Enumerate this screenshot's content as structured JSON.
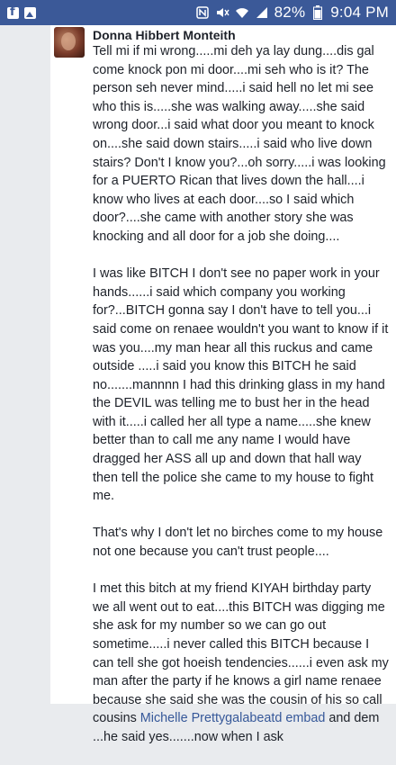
{
  "status_bar": {
    "left_icons": [
      "facebook-icon",
      "gallery-icon"
    ],
    "right_icons": [
      "nfc-icon",
      "mute-icon",
      "wifi-icon",
      "signal-icon",
      "battery-icon"
    ],
    "battery_text": "82%",
    "time": "9:04 PM"
  },
  "post": {
    "author": "Donna Hibbert Monteith",
    "paragraphs": [
      "Tell mi if mi wrong.....mi deh ya lay dung....dis gal come knock pon mi door....mi seh who is it? The person seh never mind.....i said hell no let mi see who this is.....she was walking away.....she said wrong door...i said what door you meant to knock on....she said down stairs.....i said who live down stairs? Don't I know you?...oh sorry.....i was looking for a PUERTO Rican that lives down the hall....i know who lives at each door....so I said which door?....she came with another story she was knocking and all door for a job she doing....",
      "I was like BITCH I don't see no paper work in your hands......i said which company you working for?...BITCH gonna say I don't have to tell you...i said come on renaee wouldn't you want to know if it was you....my man hear all this ruckus and came outside .....i said you know this BITCH he said no.......mannnn I had this drinking glass in my hand the DEVIL was telling me to bust her in the head with it.....i called her all type a name.....she knew better than to call me any name I would have dragged her ASS all up and down that hall way then tell the police she came to my house to fight me.",
      "That's why I don't let no birches come to my house not one because you can't trust people....",
      "I met this bitch at my friend KIYAH birthday party we all went out to eat....this BITCH was digging me she ask for my number so we can go out sometime.....i never called this BITCH because I can tell she got hoeish tendencies......i even ask my man after the party if he knows a girl name renaee because she said she was the cousin of his so call cousins"
    ],
    "mention_link": "Michelle Prettygalabeatd embad",
    "tail_text": "and dem ...he said yes.......now when I ask"
  }
}
